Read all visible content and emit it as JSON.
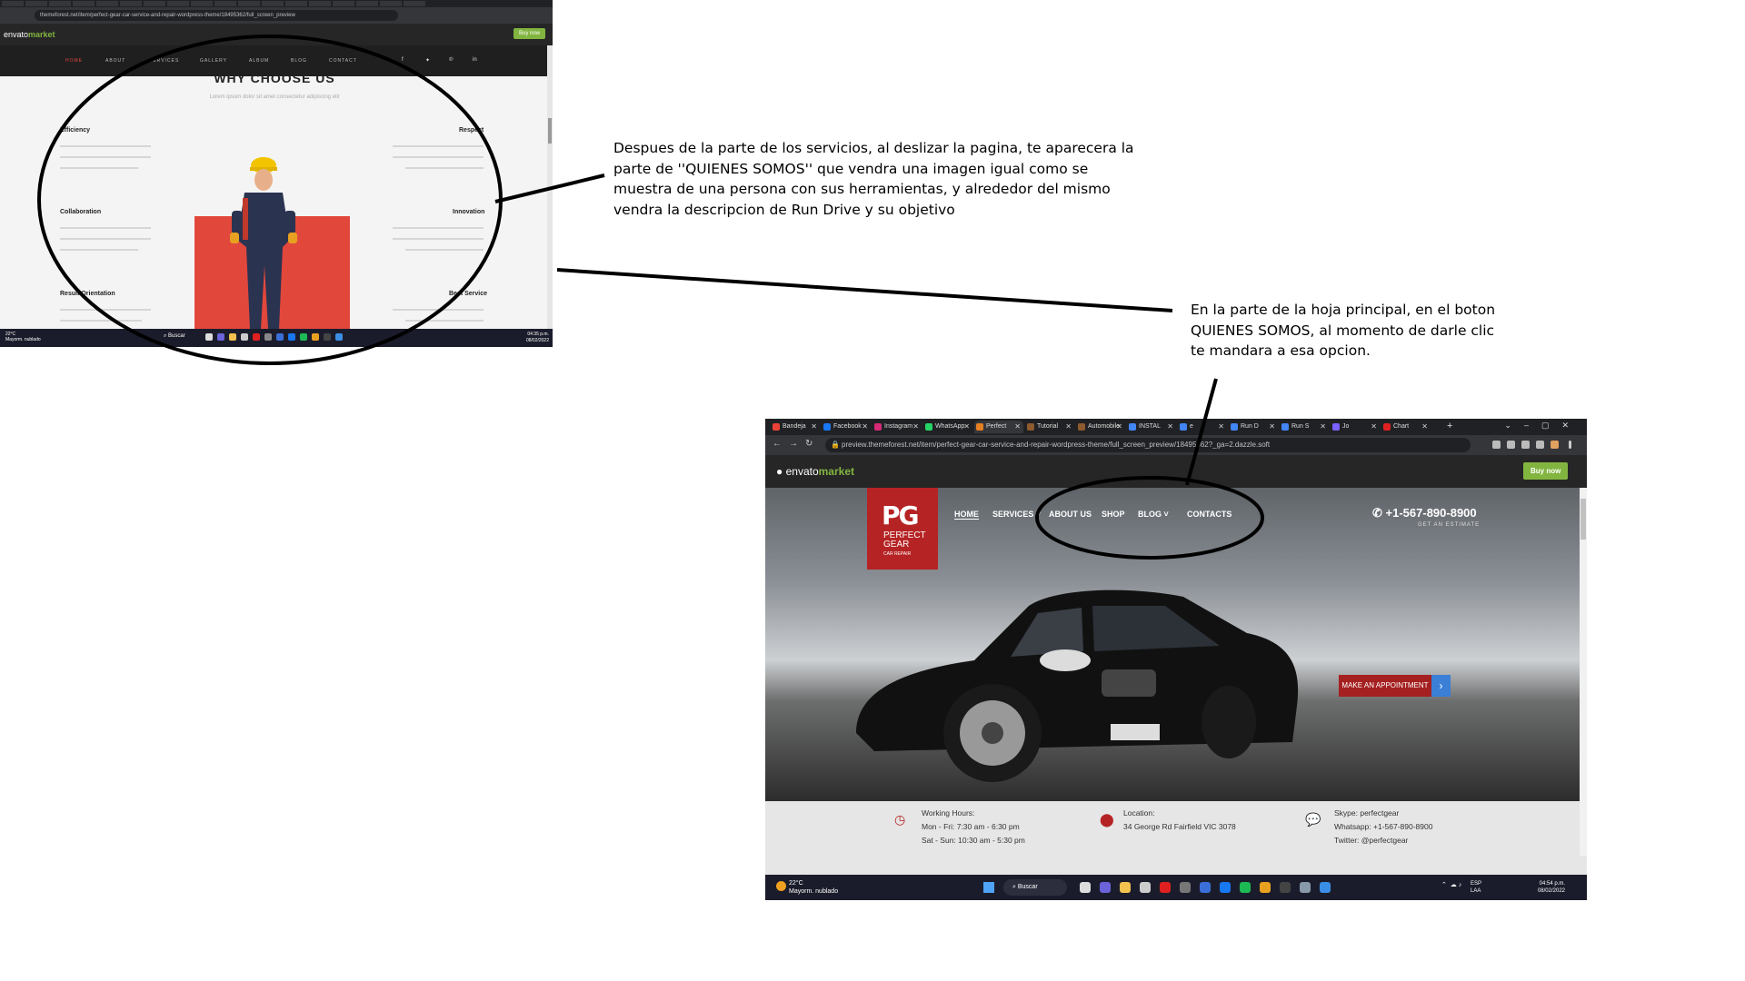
{
  "annotations": {
    "note1": "Despues de la parte de los servicios, al deslizar la pagina, te aparecera la parte de ''QUIENES SOMOS'' que vendra una imagen igual como se muestra de una persona con sus herramientas, y alrededor del mismo vendra la descripcion de Run Drive y su objetivo",
    "note2": "En la parte de la hoja principal, en el boton QUIENES SOMOS, al momento de darle clic te mandara a esa opcion."
  },
  "shot1": {
    "url": "themeforest.net/item/perfect-gear-car-service-and-repair-wordpress-theme/18495362/full_screen_preview",
    "brand_prefix": "envato",
    "brand_suffix": "market",
    "buy_label": "Buy now",
    "nav": [
      "HOME",
      "ABOUT",
      "SERVICES",
      "GALLERY",
      "ALBUM",
      "BLOG",
      "CONTACT"
    ],
    "heading": "WHY CHOOSE US",
    "subheading": "Lorem ipsum dolor sit amet consectetur adipiscing elit",
    "features": [
      "Efficiency",
      "Respect",
      "Collaboration",
      "Innovation",
      "Result Orientation",
      "Best Service"
    ],
    "weather": "22°C",
    "weather_sub": "Mayorm. nublado",
    "search": "Buscar",
    "time": "04:35 p.m.",
    "date": "08/02/2022"
  },
  "shot2": {
    "tabs": [
      "Bandeja",
      "Facebook",
      "Instagram",
      "WhatsApp",
      "Perfect",
      "Tutorial",
      "Automobile",
      "INSTAL",
      "e",
      "Run D",
      "Run S",
      "Jo",
      "Chart"
    ],
    "url": "preview.themeforest.net/item/perfect-gear-car-service-and-repair-wordpress-theme/full_screen_preview/18495362?_ga=2.dazzle.soft",
    "brand_prefix": "envato",
    "brand_suffix": "market",
    "buy_label": "Buy now",
    "logo_mark": "PG",
    "logo_name": "PERFECT GEAR",
    "logo_sub": "CAR REPAIR",
    "nav": [
      "HOME",
      "SERVICES ˅",
      "ABOUT US",
      "SHOP",
      "BLOG ˅",
      "CONTACTS"
    ],
    "phone": "+1-567-890-8900",
    "phone_sub": "GET AN ESTIMATE",
    "appointment": "MAKE AN APPOINTMENT",
    "hours_title": "Working Hours:",
    "hours_line1": "Mon - Fri: 7:30 am - 6:30 pm",
    "hours_line2": "Sat - Sun: 10:30 am - 5:30 pm",
    "location_title": "Location:",
    "location_line1": "34 George Rd Fairfield VIC 3078",
    "skype": "Skype: perfectgear",
    "whatsapp": "Whatsapp: +1-567-890-8900",
    "twitter": "Twitter: @perfectgear",
    "weather": "22°C",
    "weather_sub": "Mayorm. nublado",
    "search": "Buscar",
    "lang1": "ESP",
    "lang2": "LAA",
    "time": "04:54 p.m.",
    "date": "08/02/2022"
  }
}
